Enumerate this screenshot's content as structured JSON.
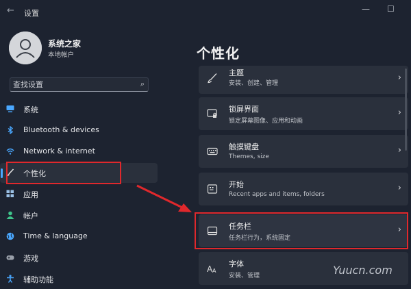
{
  "window": {
    "title": "设置",
    "back": "←",
    "minimize": "—",
    "maximize": "☐"
  },
  "user": {
    "name": "系统之家",
    "type": "本地帐户"
  },
  "search": {
    "placeholder": "查找设置",
    "icon": "search-icon"
  },
  "nav": [
    {
      "label": "系统",
      "icon": "monitor-icon",
      "color": "#4aa8ff"
    },
    {
      "label": "Bluetooth & devices",
      "icon": "bluetooth-icon",
      "color": "#4aa8ff"
    },
    {
      "label": "Network & internet",
      "icon": "wifi-icon",
      "color": "#4aa8ff"
    },
    {
      "label": "个性化",
      "icon": "brush-icon",
      "color": "#e0e0e0",
      "selected": true
    },
    {
      "label": "应用",
      "icon": "apps-icon",
      "color": "#9bc1e6"
    },
    {
      "label": "帐户",
      "icon": "person-icon",
      "color": "#3fc48b"
    },
    {
      "label": "Time & language",
      "icon": "globe-icon",
      "color": "#4aa8ff"
    },
    {
      "label": "游戏",
      "icon": "gamepad-icon",
      "color": "#9aa0aa"
    },
    {
      "label": "辅助功能",
      "icon": "accessibility-icon",
      "color": "#4aa8ff"
    }
  ],
  "page": {
    "title": "个性化"
  },
  "cards": [
    {
      "title": "主题",
      "subtitle": "安装、创建、管理",
      "icon": "brush-icon"
    },
    {
      "title": "锁屏界面",
      "subtitle": "锁定屏幕图像、应用和动画",
      "icon": "lock-screen-icon"
    },
    {
      "title": "触摸键盘",
      "subtitle": "Themes, size",
      "icon": "keyboard-icon"
    },
    {
      "title": "开始",
      "subtitle": "Recent apps and items, folders",
      "icon": "start-icon"
    },
    {
      "title": "任务栏",
      "subtitle": "任务栏行为，系统固定",
      "icon": "taskbar-icon",
      "highlighted": true
    },
    {
      "title": "字体",
      "subtitle": "安装、管理",
      "icon": "font-icon"
    }
  ],
  "chevron": "›",
  "highlight_color": "#e0282c",
  "accent_color": "#4aa8ff",
  "watermark": "Yuucn.com"
}
